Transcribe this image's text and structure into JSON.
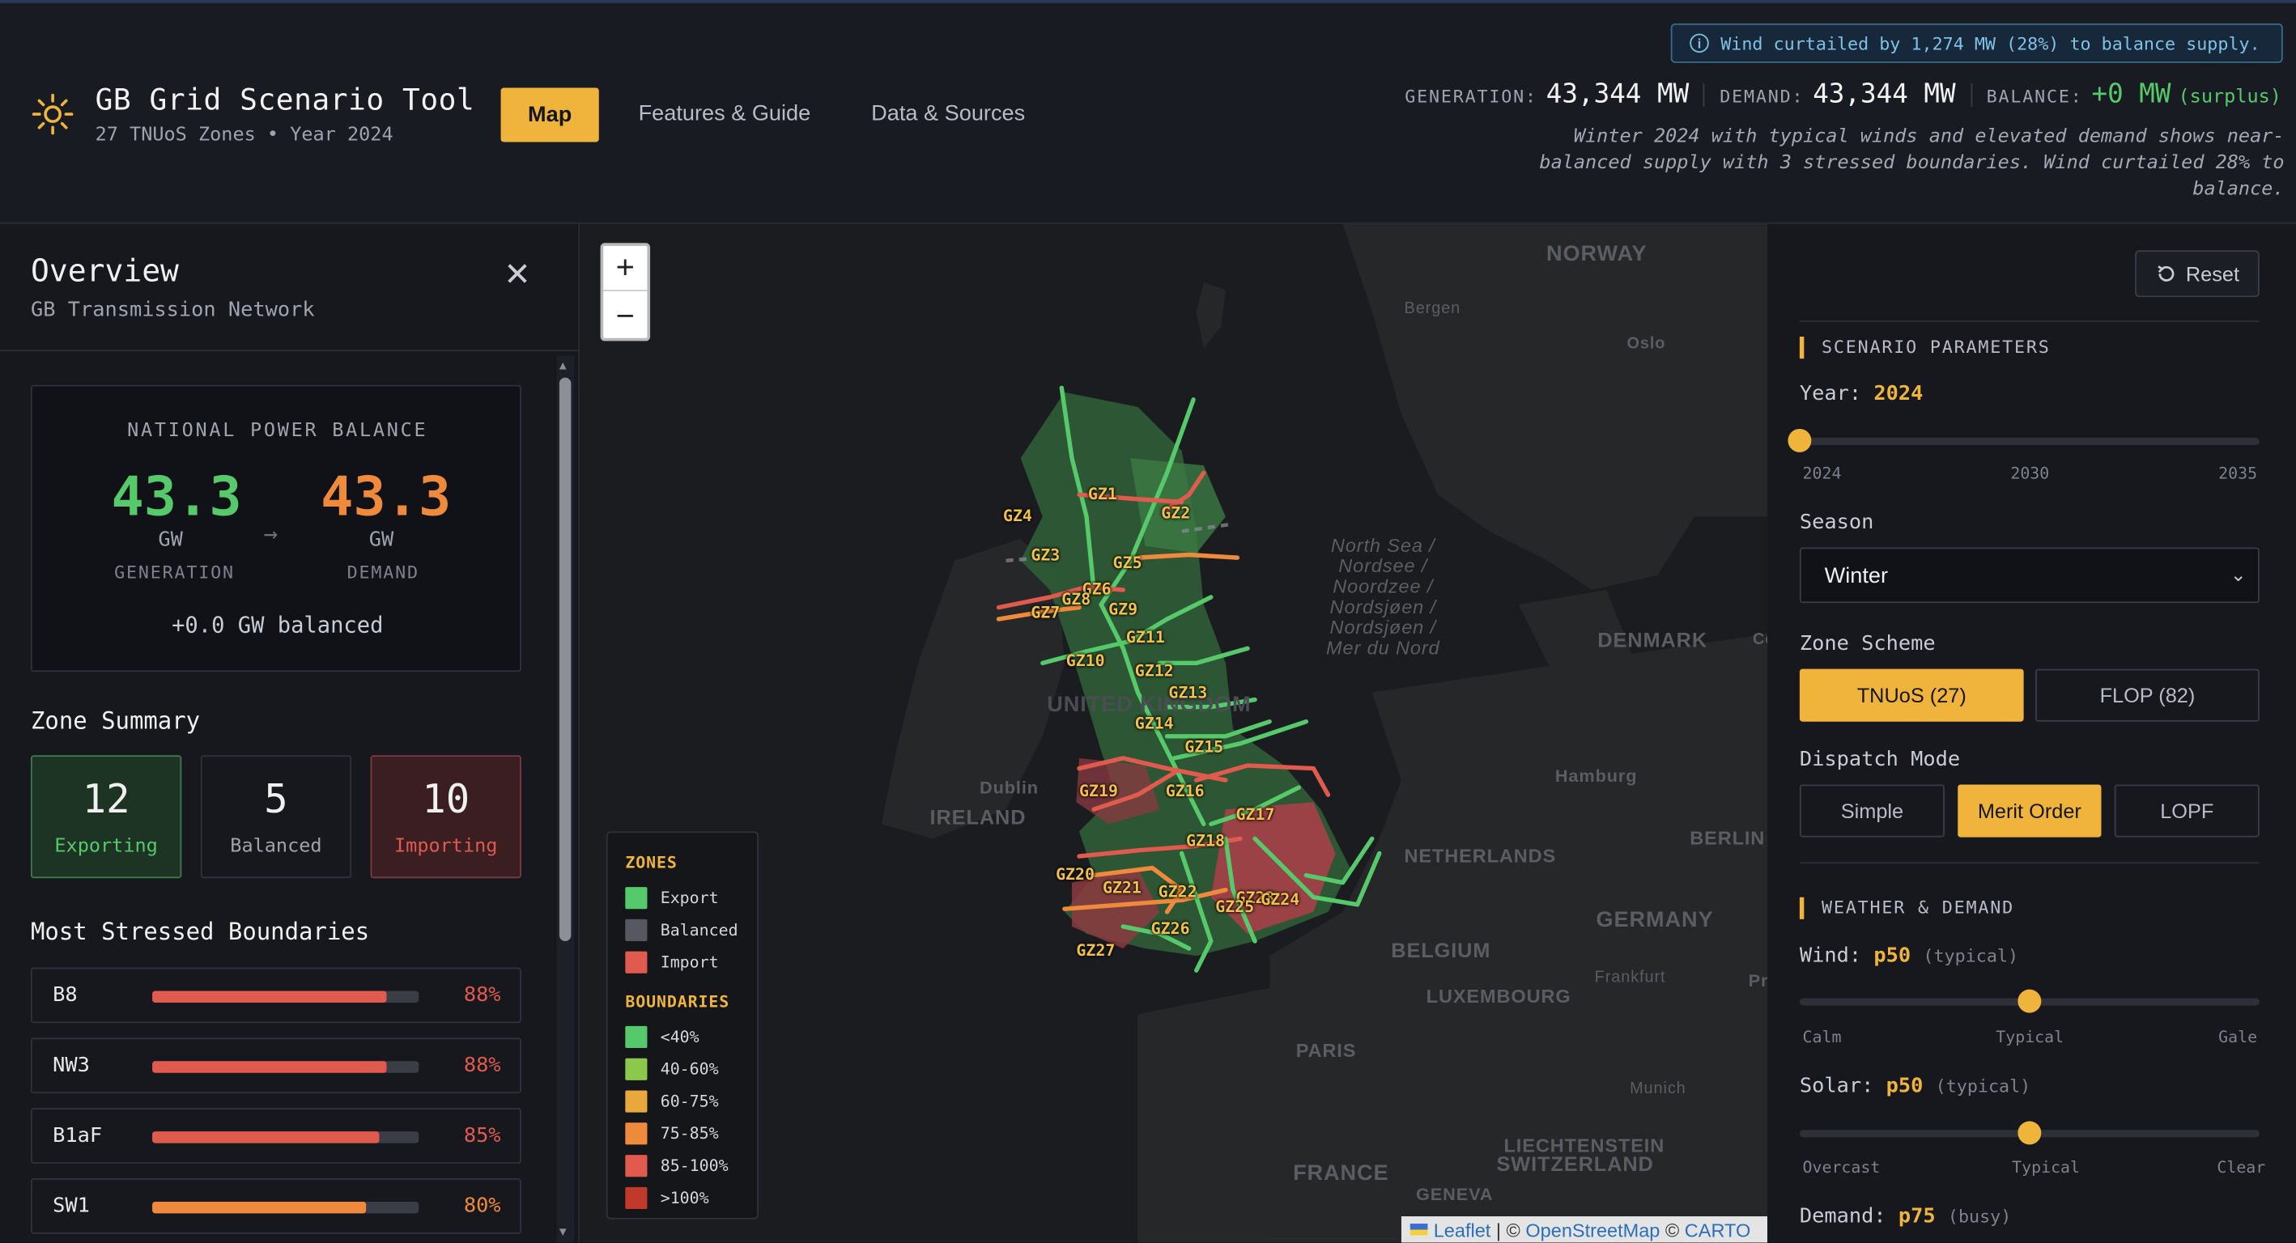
{
  "header": {
    "title": "GB Grid Scenario Tool",
    "subtitle": "27 TNUoS Zones • Year 2024",
    "nav": {
      "map": "Map",
      "features": "Features & Guide",
      "data": "Data & Sources"
    },
    "alert": "Wind curtailed by 1,274 MW (28%) to balance supply.",
    "stats": {
      "generation_label": "GENERATION:",
      "generation_value": "43,344 MW",
      "demand_label": "DEMAND:",
      "demand_value": "43,344 MW",
      "balance_label": "BALANCE:",
      "balance_value": "+0 MW",
      "balance_note": "(surplus)"
    },
    "description": "Winter 2024 with typical winds and elevated demand shows near-balanced supply with 3 stressed boundaries. Wind curtailed 28% to balance."
  },
  "overview": {
    "title": "Overview",
    "subtitle": "GB Transmission Network",
    "npb": {
      "title": "NATIONAL POWER BALANCE",
      "generation": "43.3",
      "demand": "43.3",
      "unit": "GW",
      "gen_caption": "GENERATION",
      "dem_caption": "DEMAND",
      "note": "+0.0 GW balanced",
      "arrow": "→"
    },
    "zone_summary": {
      "title": "Zone Summary",
      "exporting": {
        "count": "12",
        "label": "Exporting"
      },
      "balanced": {
        "count": "5",
        "label": "Balanced"
      },
      "importing": {
        "count": "10",
        "label": "Importing"
      }
    },
    "stressed": {
      "title": "Most Stressed Boundaries",
      "items": [
        {
          "name": "B8",
          "pct": "88%",
          "value": 0.88,
          "color": "#e05a4e"
        },
        {
          "name": "NW3",
          "pct": "88%",
          "value": 0.88,
          "color": "#e05a4e"
        },
        {
          "name": "B1aF",
          "pct": "85%",
          "value": 0.85,
          "color": "#e05a4e"
        },
        {
          "name": "SW1",
          "pct": "80%",
          "value": 0.8,
          "color": "#ef8a3c"
        }
      ]
    }
  },
  "map": {
    "zoom_in": "+",
    "zoom_out": "−",
    "places": {
      "norway": "NORWAY",
      "bergen": "Bergen",
      "oslo": "Oslo",
      "denmark": "DENMARK",
      "cop": "Cop",
      "north_sea": "North Sea / Nordsee / Noordzee / Nordsjøen / Nordsjøen / Mer du Nord",
      "uk": "UNITED KINGDOM",
      "dublin": "Dublin",
      "ireland": "IRELAND",
      "hamburg": "Hamburg",
      "berlin": "BERLIN",
      "netherlands": "NETHERLANDS",
      "germany": "GERMANY",
      "belgium": "BELGIUM",
      "luxembourg": "LUXEMBOURG",
      "frankfurt": "Frankfurt",
      "paris": "PARIS",
      "munich": "Munich",
      "liechtenstein": "LIECHTENSTEIN",
      "switzerland": "SWITZERLAND",
      "france": "FRANCE",
      "geneva": "GENEVA",
      "pra": "Pra"
    },
    "zones": [
      "GZ1",
      "GZ2",
      "GZ3",
      "GZ4",
      "GZ5",
      "GZ6",
      "GZ7",
      "GZ8",
      "GZ9",
      "GZ10",
      "GZ11",
      "GZ12",
      "GZ13",
      "GZ14",
      "GZ15",
      "GZ16",
      "GZ17",
      "GZ18",
      "GZ19",
      "GZ20",
      "GZ21",
      "GZ22",
      "GZ23",
      "GZ24",
      "GZ25",
      "GZ26",
      "GZ27"
    ],
    "legend": {
      "zones_title": "ZONES",
      "zones": [
        {
          "label": "Export",
          "color": "#56c96a"
        },
        {
          "label": "Balanced",
          "color": "#55585f"
        },
        {
          "label": "Import",
          "color": "#e05a4e"
        }
      ],
      "boundaries_title": "BOUNDARIES",
      "boundaries": [
        {
          "label": "<40%",
          "color": "#56c96a"
        },
        {
          "label": "40-60%",
          "color": "#8cc84b"
        },
        {
          "label": "60-75%",
          "color": "#e8a83c"
        },
        {
          "label": "75-85%",
          "color": "#ef8a3c"
        },
        {
          "label": "85-100%",
          "color": "#e05a4e"
        },
        {
          "label": ">100%",
          "color": "#c0392b"
        }
      ]
    },
    "attribution": {
      "leaflet": "Leaflet",
      "sep1": " | © ",
      "osm": "OpenStreetMap",
      "sep2": " © ",
      "carto": "CARTO"
    }
  },
  "params": {
    "reset": "Reset",
    "scenario_title": "SCENARIO PARAMETERS",
    "year_label": "Year:",
    "year_value": "2024",
    "year_level": 0,
    "year_ticks": [
      "2024",
      "2030",
      "2035"
    ],
    "season_label": "Season",
    "season_value": "Winter",
    "zone_scheme_label": "Zone Scheme",
    "zone_schemes": [
      {
        "label": "TNUoS (27)",
        "active": true
      },
      {
        "label": "FLOP (82)",
        "active": false
      }
    ],
    "dispatch_label": "Dispatch Mode",
    "dispatch_modes": [
      {
        "label": "Simple",
        "active": false
      },
      {
        "label": "Merit Order",
        "active": true
      },
      {
        "label": "LOPF",
        "active": false
      }
    ],
    "weather_title": "WEATHER & DEMAND",
    "wind_label": "Wind:",
    "wind_value": "p50",
    "wind_note": "(typical)",
    "wind_level": 0.5,
    "wind_ticks": [
      "Calm",
      "Typical",
      "Gale"
    ],
    "solar_label": "Solar:",
    "solar_value": "p50",
    "solar_note": "(typical)",
    "solar_level": 0.5,
    "solar_ticks": [
      "Overcast",
      "Typical",
      "Clear"
    ],
    "demand_label": "Demand:",
    "demand_value": "p75",
    "demand_note": "(busy)"
  }
}
